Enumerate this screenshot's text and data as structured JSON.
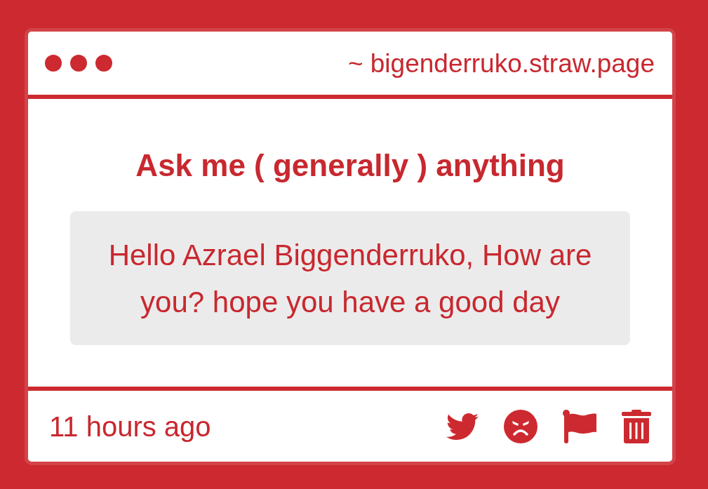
{
  "address_bar": {
    "url": "~ bigenderruko.straw.page"
  },
  "question": {
    "title": "Ask me ( generally ) anything",
    "message": "Hello Azrael Biggenderruko, How are you? hope you have a good day"
  },
  "footer": {
    "timestamp": "11 hours ago"
  }
}
